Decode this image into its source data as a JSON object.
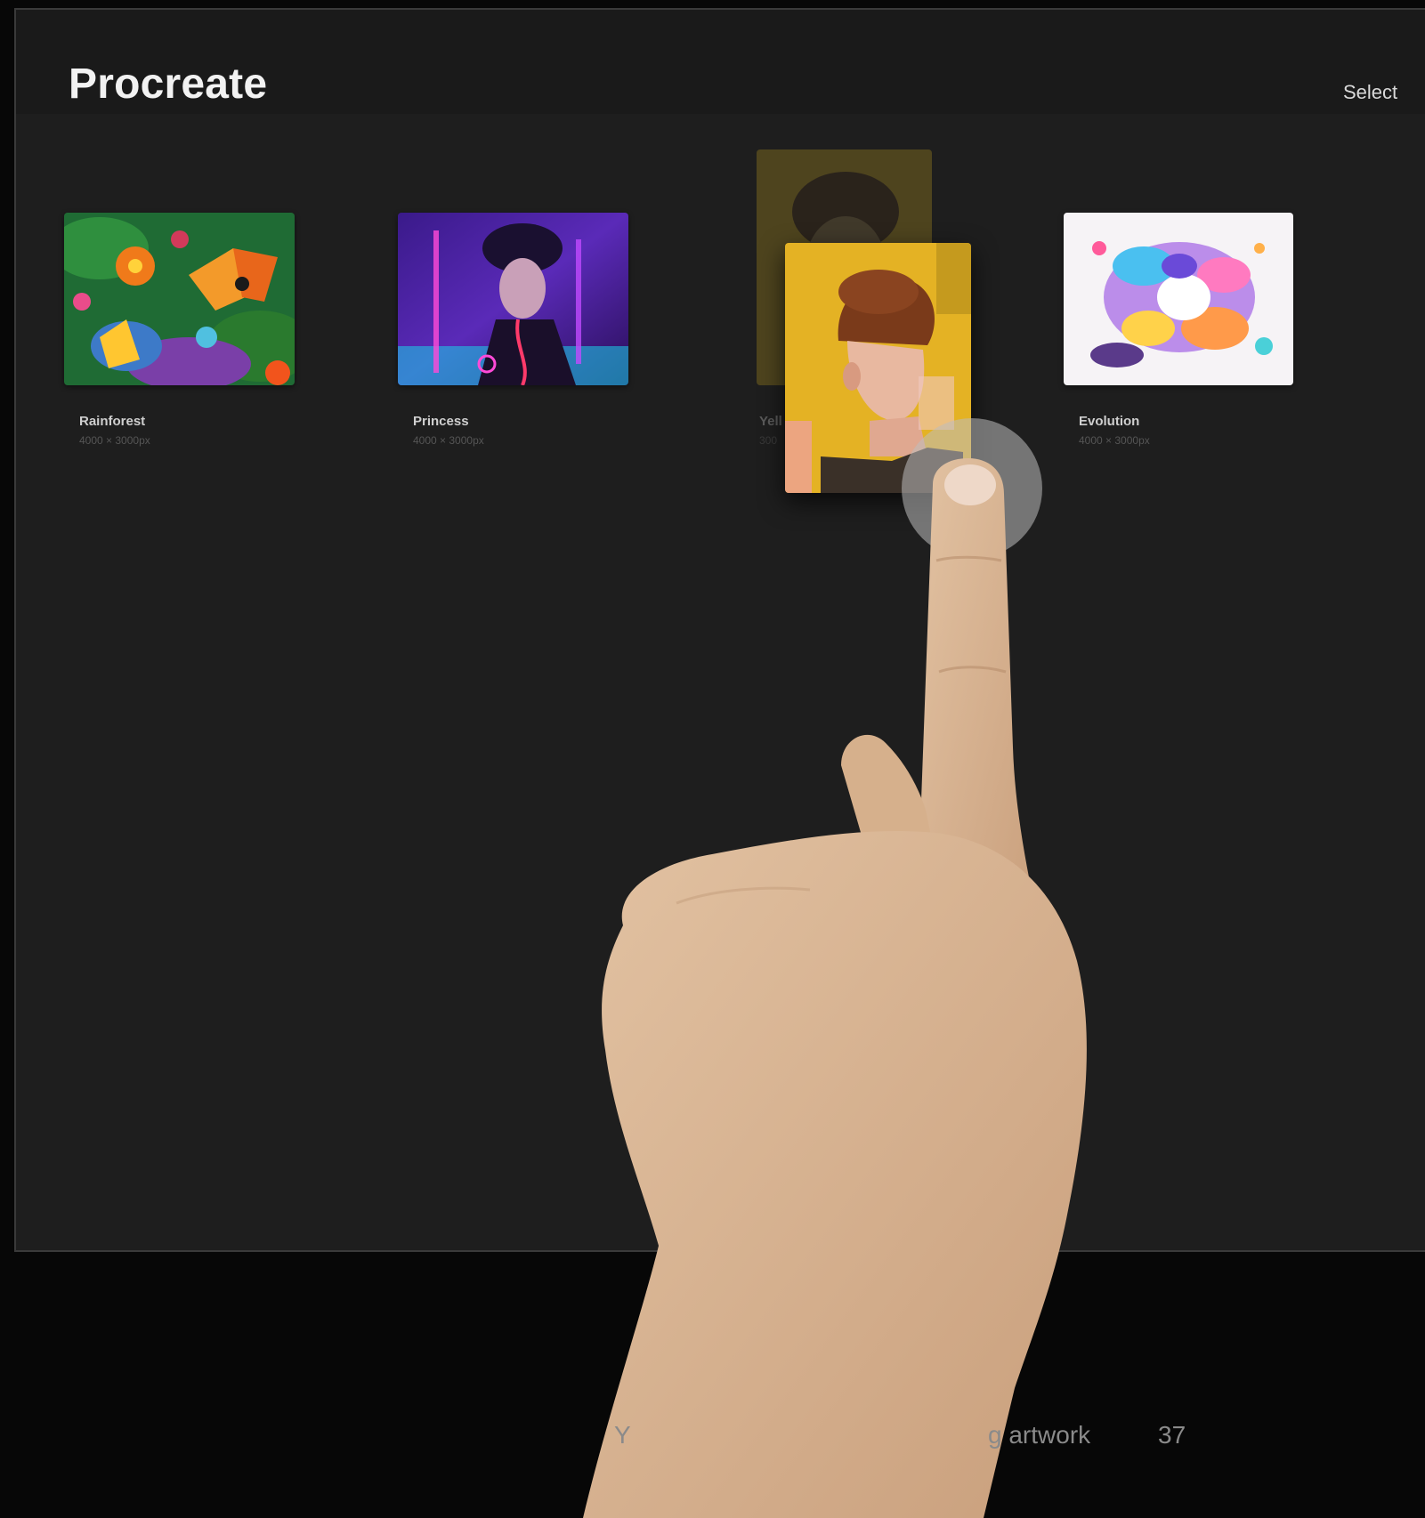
{
  "app": {
    "title": "Procreate",
    "select_label": "Select"
  },
  "gallery": {
    "artworks": [
      {
        "name": "Rainforest",
        "size": "4000 × 3000px"
      },
      {
        "name": "Princess",
        "size": "4000 × 3000px"
      },
      {
        "name": "Yell",
        "size": "300"
      },
      {
        "name": "Evolution",
        "size": "4000 × 3000px"
      }
    ]
  },
  "footer": {
    "caption_left": "Y",
    "caption": "g artwork",
    "page_number": "37"
  },
  "colors": {
    "screen_bg": "#1e1e1e",
    "topbar_bg": "#1a1a1a",
    "outer_bg": "#070707",
    "drag_card_accent": "#e4b224",
    "skin": "#d7b08e"
  },
  "icons": [
    "touch-indicator-icon",
    "hand-pointer-icon"
  ]
}
